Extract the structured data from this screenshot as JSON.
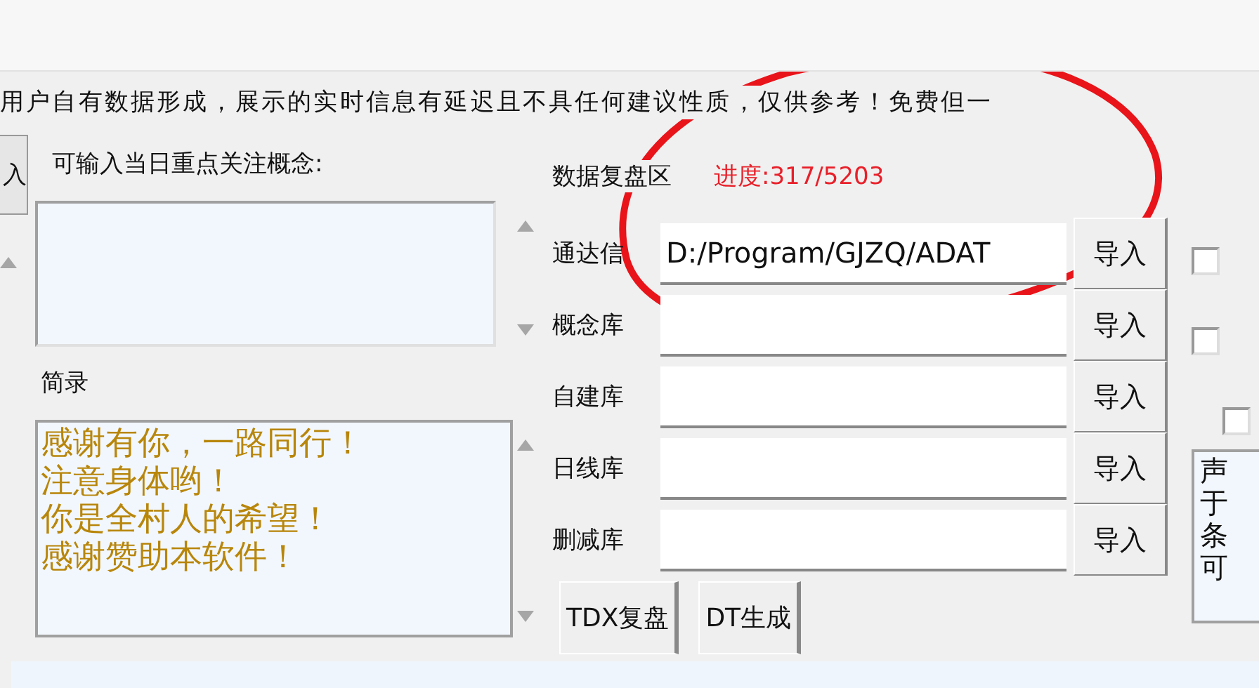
{
  "notice": "用户自有数据形成，展示的实时信息有延迟且不具任何建议性质，仅供参考！免费但一",
  "side_button": "入",
  "concept": {
    "label": "可输入当日重点关注概念:"
  },
  "notes": {
    "label": "简录",
    "lines": [
      "感谢有你，一路同行！",
      "注意身体哟！",
      "你是全村人的希望！",
      "感谢赞助本软件！"
    ]
  },
  "data_section": {
    "title": "数据复盘区",
    "progress": "进度:317/5203",
    "rows": [
      {
        "label": "通达信",
        "value": "D:/Program/GJZQ/ADAT",
        "button": "导入"
      },
      {
        "label": "概念库",
        "button": "导入"
      },
      {
        "label": "自建库",
        "button": "导入"
      },
      {
        "label": "日线库",
        "button": "导入"
      },
      {
        "label": "删减库",
        "button": "导入"
      }
    ],
    "actions": [
      "TDX复盘",
      "DT生成"
    ]
  },
  "checkboxes": [
    {
      "checked": false
    },
    {
      "checked": false
    },
    {
      "checked": false
    }
  ],
  "disclaimer": [
    "声",
    "于",
    "条",
    "可"
  ]
}
